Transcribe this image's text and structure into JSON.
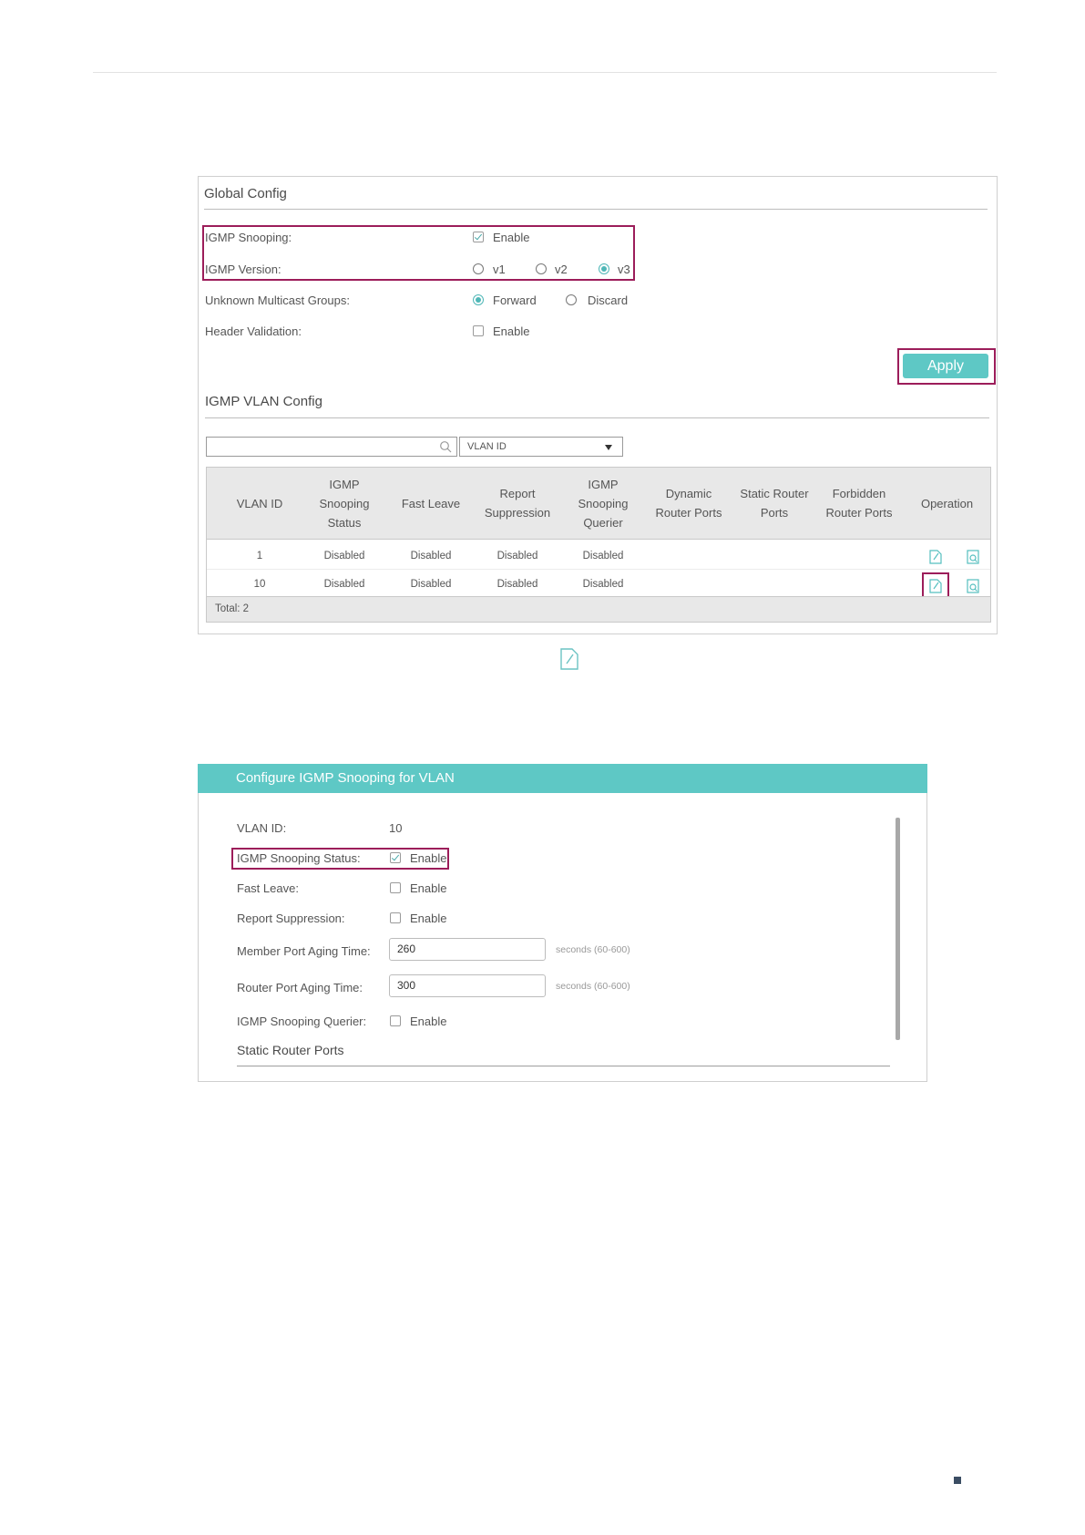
{
  "global_config": {
    "title": "Global Config",
    "igmp_snooping": {
      "label": "IGMP Snooping:",
      "option": "Enable",
      "checked": true
    },
    "igmp_version": {
      "label": "IGMP Version:",
      "options": [
        "v1",
        "v2",
        "v3"
      ],
      "selected": "v3"
    },
    "unknown_multicast": {
      "label": "Unknown Multicast Groups:",
      "options": [
        "Forward",
        "Discard"
      ],
      "selected": "Forward"
    },
    "header_validation": {
      "label": "Header Validation:",
      "option": "Enable",
      "checked": false
    },
    "apply_label": "Apply"
  },
  "vlan_config": {
    "title": "IGMP VLAN Config",
    "search": {
      "value": "",
      "select_value": "VLAN ID",
      "search_icon": "magnifier-icon",
      "dropdown_icon": "triangle-down-icon"
    },
    "columns": [
      "VLAN ID",
      "IGMP\nSnooping\nStatus",
      "Fast Leave",
      "Report\nSuppression",
      "IGMP\nSnooping\nQuerier",
      "Dynamic\nRouter Ports",
      "Static Router\nPorts",
      "Forbidden\nRouter Ports",
      "Operation"
    ],
    "rows": [
      {
        "vlan_id": "1",
        "status": "Disabled",
        "fast_leave": "Disabled",
        "report_suppression": "Disabled",
        "querier": "Disabled"
      },
      {
        "vlan_id": "10",
        "status": "Disabled",
        "fast_leave": "Disabled",
        "report_suppression": "Disabled",
        "querier": "Disabled"
      }
    ],
    "operation_icons": [
      "edit-icon",
      "detail-icon"
    ],
    "total": "Total: 2"
  },
  "standalone_icon": "edit-icon",
  "dialog": {
    "title": "Configure IGMP Snooping for VLAN",
    "vlan_id": {
      "label": "VLAN ID:",
      "value": "10"
    },
    "snooping_status": {
      "label": "IGMP Snooping Status:",
      "option": "Enable",
      "checked": true
    },
    "fast_leave": {
      "label": "Fast Leave:",
      "option": "Enable",
      "checked": false
    },
    "report_suppression": {
      "label": "Report Suppression:",
      "option": "Enable",
      "checked": false
    },
    "member_port_aging": {
      "label": "Member Port Aging Time:",
      "value": "260",
      "hint": "seconds (60-600)"
    },
    "router_port_aging": {
      "label": "Router Port Aging Time:",
      "value": "300",
      "hint": "seconds (60-600)"
    },
    "querier": {
      "label": "IGMP Snooping Querier:",
      "option": "Enable",
      "checked": false
    },
    "static_router_ports": "Static Router Ports"
  },
  "colors": {
    "accent": "#5ec8c5",
    "highlight": "#9c1d5a",
    "footer_square": "#3b4d63"
  }
}
